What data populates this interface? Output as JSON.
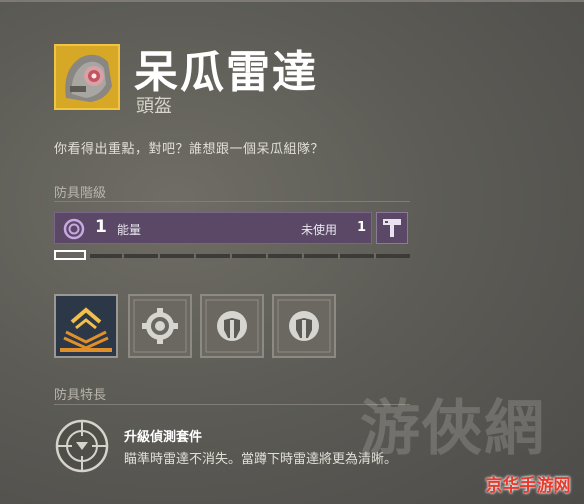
{
  "item": {
    "name": "呆瓜雷達",
    "type": "頭盔",
    "flavor_text": "你看得出重點，對吧？誰想跟一個呆瓜組隊？",
    "icon": "helmet-icon"
  },
  "armor_tier": {
    "label": "防具階級",
    "energy_value": "1",
    "energy_label": "能量",
    "unused_label": "未使用",
    "unused_value": "1",
    "energy_progress": 0.1,
    "upgrade_icon": "hammer-icon",
    "color_energy": "#5a4866"
  },
  "mods": [
    {
      "icon": "armor-chevron-mod-icon"
    },
    {
      "icon": "gear-socket-icon"
    },
    {
      "icon": "helmet-socket-icon"
    },
    {
      "icon": "helmet-socket-icon"
    }
  ],
  "perks": {
    "label": "防具特長",
    "items": [
      {
        "name": "升級偵測套件",
        "description": "瞄準時雷達不消失。當蹲下時雷達將更為清晰。",
        "icon": "crosshair-perk-icon"
      }
    ]
  },
  "watermark": {
    "text": "游俠網",
    "badge": "京华手游网"
  }
}
